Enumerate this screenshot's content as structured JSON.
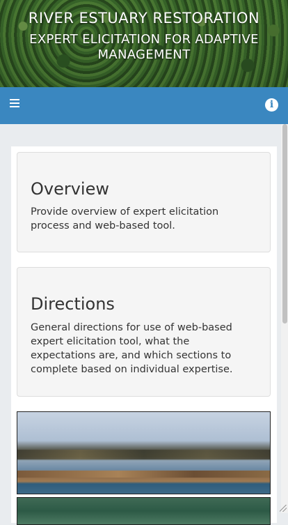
{
  "header": {
    "title": "RIVER ESTUARY RESTORATION",
    "subtitle": "EXPERT ELICITATION FOR ADAPTIVE MANAGEMENT"
  },
  "toolbar": {
    "menu_icon": "hamburger-menu-icon",
    "info_icon": "info-circle-icon",
    "accent_color": "#3a87c0"
  },
  "sections": {
    "overview": {
      "heading": "Overview",
      "body": "Provide overview of expert elicitation process and web-based tool."
    },
    "directions": {
      "heading": "Directions",
      "body": "General directions for use of web-based expert elicitation tool, what the expectations are, and which sections to complete based on individual expertise."
    }
  }
}
